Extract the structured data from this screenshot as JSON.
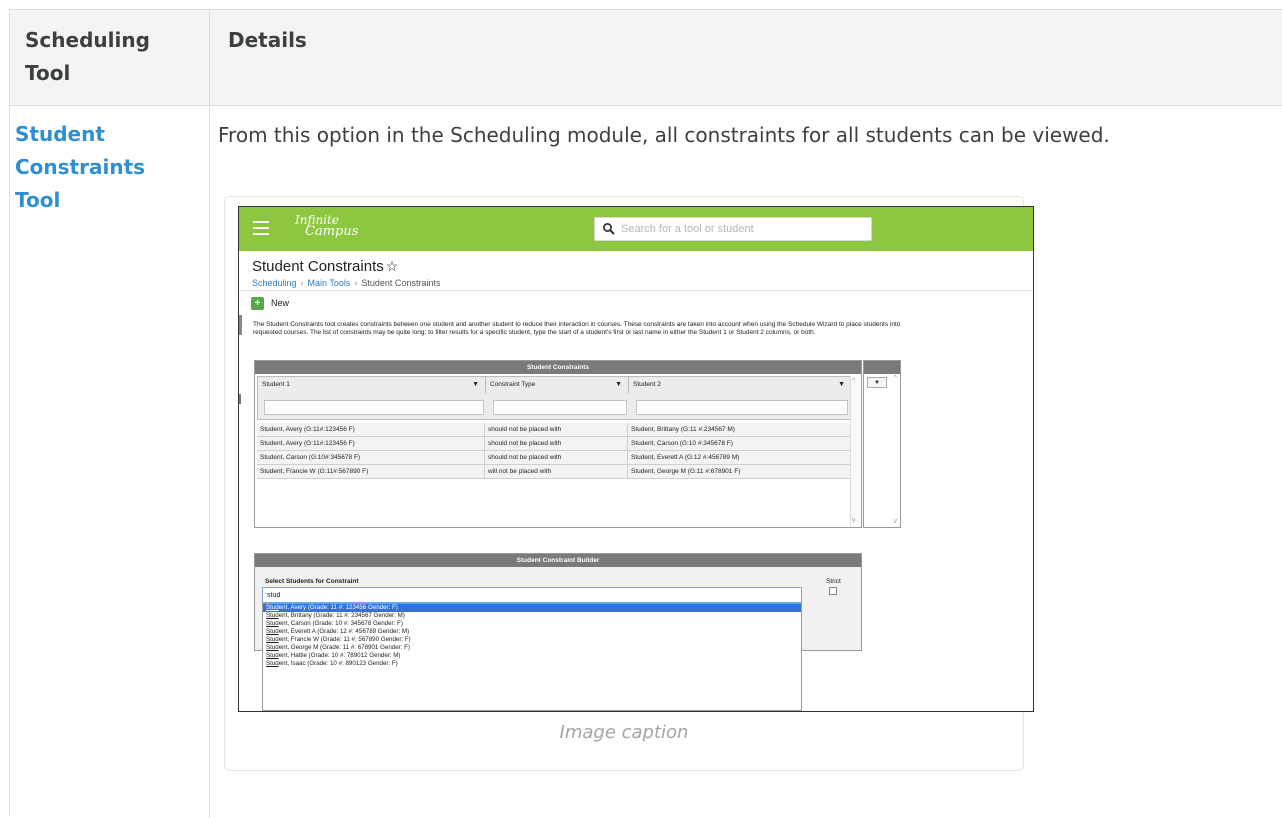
{
  "doc": {
    "header_tool": "Scheduling Tool",
    "header_details": "Details",
    "tool_link": "Student Constraints Tool",
    "details_text": "From this option in the Scheduling module, all constraints for all students can be viewed.",
    "caption": "Image caption"
  },
  "app": {
    "logo_line1": "Infinite",
    "logo_line2": "Campus",
    "search_placeholder": "Search for a tool or student",
    "page_title": "Student Constraints",
    "breadcrumb": [
      "Scheduling",
      "Main Tools",
      "Student Constraints"
    ],
    "new_label": "New",
    "description": "The Student Constraints tool creates constraints between one student and another student to reduce their interaction in courses. These constraints are taken into account when using the Schedule Wizard to place students into requested courses. The list of constraints may be quite long; to filter results for a specific student, type the start of a student's first or last name in either the Student 1 or Student 2 columns, or both.",
    "constraints_panel": {
      "title": "Student Constraints",
      "columns": [
        "Student 1",
        "Constraint Type",
        "Student 2"
      ],
      "rows": [
        [
          "Student, Avery (G:11#:123456 F)",
          "should not be placed with",
          "Student, Brittany (G:11 #:234567 M)"
        ],
        [
          "Student, Avery (G:11#:123456 F)",
          "should not be placed with",
          "Student, Carson (G:10 #:345678 F)"
        ],
        [
          "Student, Carson (G:10#:345678 F)",
          "should not be placed with",
          "Student, Everett A (G:12 #:456789 M)"
        ],
        [
          "Student, Francie W (G:11#:567890 F)",
          "will not be placed with",
          "Student, George M (G:11 #:678901 F)"
        ]
      ]
    },
    "builder": {
      "title": "Student Constraint Builder",
      "select_label": "Select Students for Constraint",
      "strict_label": "Strict",
      "input_value": "stud",
      "options": [
        {
          "match": "Stud",
          "rest": "ent, Avery (Grade: 11 #: 123456 Gender: F)"
        },
        {
          "match": "Stud",
          "rest": "ent, Brittany (Grade: 11 #: 234567 Gender: M)"
        },
        {
          "match": "Stud",
          "rest": "ent, Carson (Grade: 10 #: 345678 Gender: F)"
        },
        {
          "match": "Stud",
          "rest": "ent, Everett A (Grade: 12 #: 456789 Gender: M)"
        },
        {
          "match": "Stud",
          "rest": "ent, Francie W (Grade: 11 #: 567890 Gender: F)"
        },
        {
          "match": "Stud",
          "rest": "ent, George M (Grade: 11 #: 678901 Gender: F)"
        },
        {
          "match": "Stud",
          "rest": "ent, Hattie (Grade: 10 #: 789012 Gender: M)"
        },
        {
          "match": "Stud",
          "rest": "ent, Isaac (Grade: 10 #: 890123 Gender: F)"
        }
      ]
    }
  },
  "colors": {
    "link": "#2f8fd0",
    "topbar": "#8dc63f",
    "panel_header": "#7a7a7a",
    "selected_option": "#3a70d2"
  }
}
